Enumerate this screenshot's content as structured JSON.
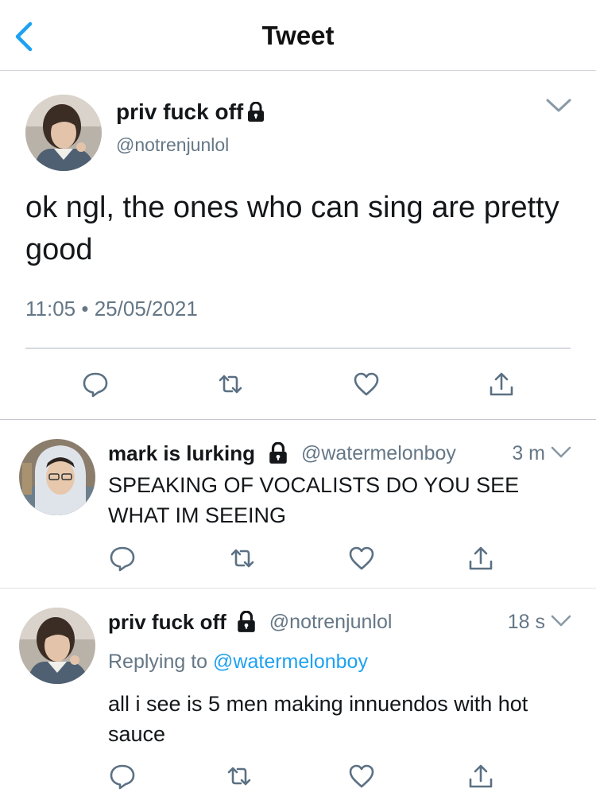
{
  "header": {
    "title": "Tweet"
  },
  "main_tweet": {
    "display_name": "priv fuck off",
    "handle": "@notrenjunlol",
    "text": "ok ngl, the ones who can sing are pretty good",
    "time": "11:05",
    "separator": "•",
    "date": "25/05/2021"
  },
  "replies": [
    {
      "display_name": "mark is lurking",
      "handle": "@watermelonboy",
      "time_ago": "3 m",
      "text": "SPEAKING OF VOCALISTS DO YOU SEE WHAT IM SEEING"
    },
    {
      "display_name": "priv fuck off",
      "handle": "@notrenjunlol",
      "time_ago": "18 s",
      "replying_prefix": "Replying to",
      "replying_handle": "@watermelonboy",
      "text": "all i see is 5 men making innuendos with hot sauce"
    }
  ],
  "colors": {
    "accent": "#1da1f2",
    "icon": "#5b7083",
    "secondary_text": "#657786",
    "primary_text": "#14171a"
  },
  "icons": [
    "back-chevron-icon",
    "lock-icon",
    "chevron-down-icon",
    "reply-icon",
    "retweet-icon",
    "like-icon",
    "share-icon"
  ]
}
